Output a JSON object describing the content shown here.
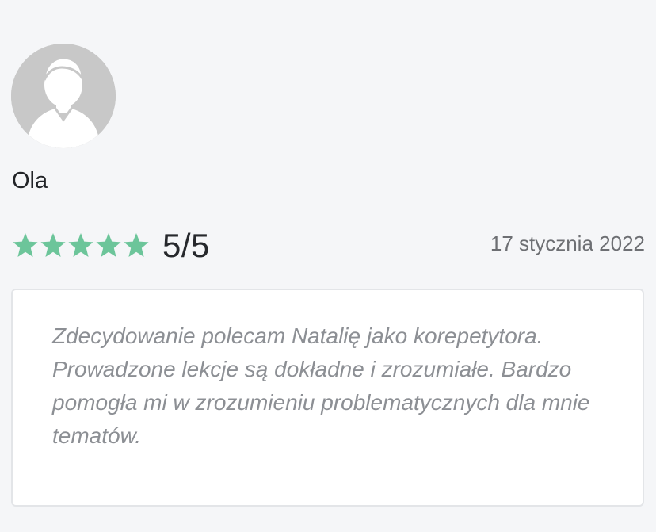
{
  "reviewer": {
    "name": "Ola",
    "avatar_icon": "user-silhouette-icon"
  },
  "rating": {
    "stars_filled": 5,
    "stars_total": 5,
    "score_text": "5/5",
    "star_color": "#6cc59a"
  },
  "review": {
    "date": "17 stycznia 2022",
    "text": "Zdecydowanie polecam Natalię jako korepetytora. Prowadzone lekcje są dokładne i zrozumiałe. Bardzo pomogła mi w zrozumieniu problematycznych dla mnie tematów."
  }
}
